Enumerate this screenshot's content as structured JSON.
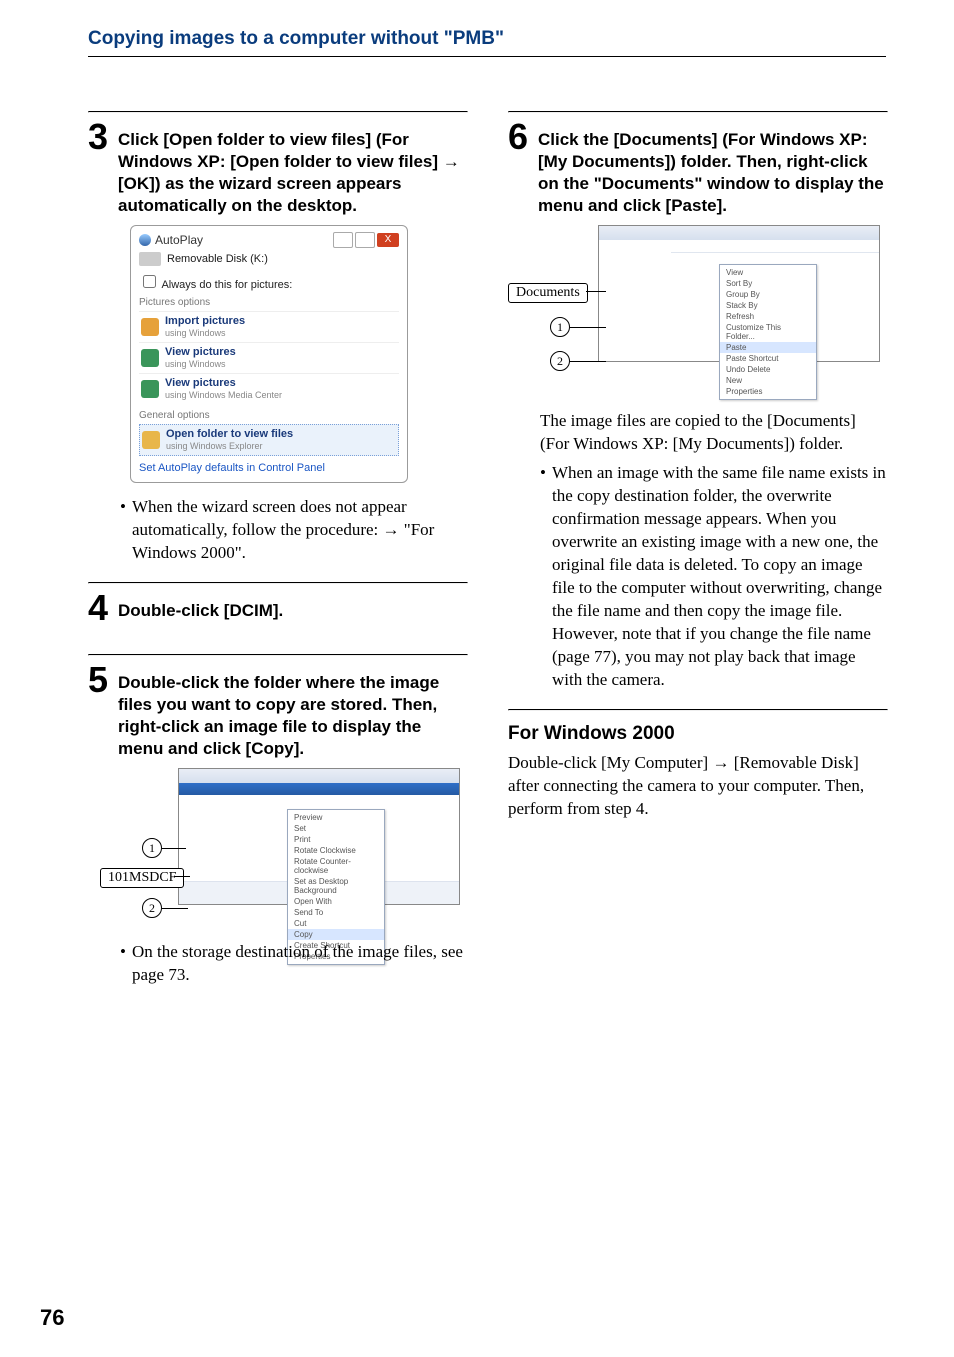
{
  "header": {
    "title": "Copying images to a computer without \"PMB\""
  },
  "pageNumber": "76",
  "steps": {
    "s3": {
      "num": "3",
      "text_a": "Click [Open folder to view files] (For Windows XP: [Open folder to view files] ",
      "arrow": "→",
      "text_b": " [OK]) as the wizard screen appears automatically on the desktop."
    },
    "s4": {
      "num": "4",
      "text": "Double-click [DCIM]."
    },
    "s5": {
      "num": "5",
      "text": "Double-click the folder where the image files you want to copy are stored. Then, right-click an image file to display the menu and click [Copy]."
    },
    "s6": {
      "num": "6",
      "text": "Click the [Documents] (For Windows XP: [My Documents]) folder. Then, right-click on the \"Documents\" window to display the menu and click [Paste]."
    }
  },
  "notes": {
    "n3": "When the wizard screen does not appear automatically, follow the procedure: → \"For Windows 2000\".",
    "n5": "On the storage destination of the image files, see page 73.",
    "r_para": "The image files are copied to the [Documents] (For Windows XP: [My Documents]) folder.",
    "n6": "When an image with the same file name exists in the copy destination folder, the overwrite confirmation message appears. When you overwrite an existing image with a new one, the original file data is deleted. To copy an image file to the computer without overwriting, change the file name and then copy the image file. However, note that if you change the file name (page 77), you may not play back that image with the camera."
  },
  "win2000": {
    "heading": "For Windows 2000",
    "body_a": "Double-click [My Computer] ",
    "arrow": "→",
    "body_b": " [Removable Disk] after connecting the camera to your computer. Then, perform from step 4."
  },
  "autoplay": {
    "title": "AutoPlay",
    "drive": "Removable Disk (K:)",
    "always": "Always do this for pictures:",
    "section1": "Pictures options",
    "rows": [
      {
        "t": "Import pictures",
        "s": "using Windows"
      },
      {
        "t": "View pictures",
        "s": "using Windows"
      },
      {
        "t": "View pictures",
        "s": "using Windows Media Center"
      }
    ],
    "section2": "General options",
    "open": {
      "t": "Open folder to view files",
      "s": "using Windows Explorer"
    },
    "link": "Set AutoPlay defaults in Control Panel"
  },
  "fig5": {
    "callout1": "101MSDCF",
    "menu": [
      "Preview",
      "Set",
      "Print",
      "Rotate Clockwise",
      "Rotate Counter-clockwise",
      "Set as Desktop Background",
      "Open With",
      "Send To",
      "Cut",
      "Copy",
      "Create Shortcut",
      "Properties"
    ],
    "copy": "Copy",
    "c1": "1",
    "c2": "2"
  },
  "fig6": {
    "callout": "Documents",
    "menu": [
      "View",
      "Sort By",
      "Group By",
      "Stack By",
      "Refresh",
      "Customize This Folder...",
      "Paste",
      "Paste Shortcut",
      "Undo Delete",
      "New",
      "Properties"
    ],
    "paste": "Paste",
    "c1": "1",
    "c2": "2"
  }
}
